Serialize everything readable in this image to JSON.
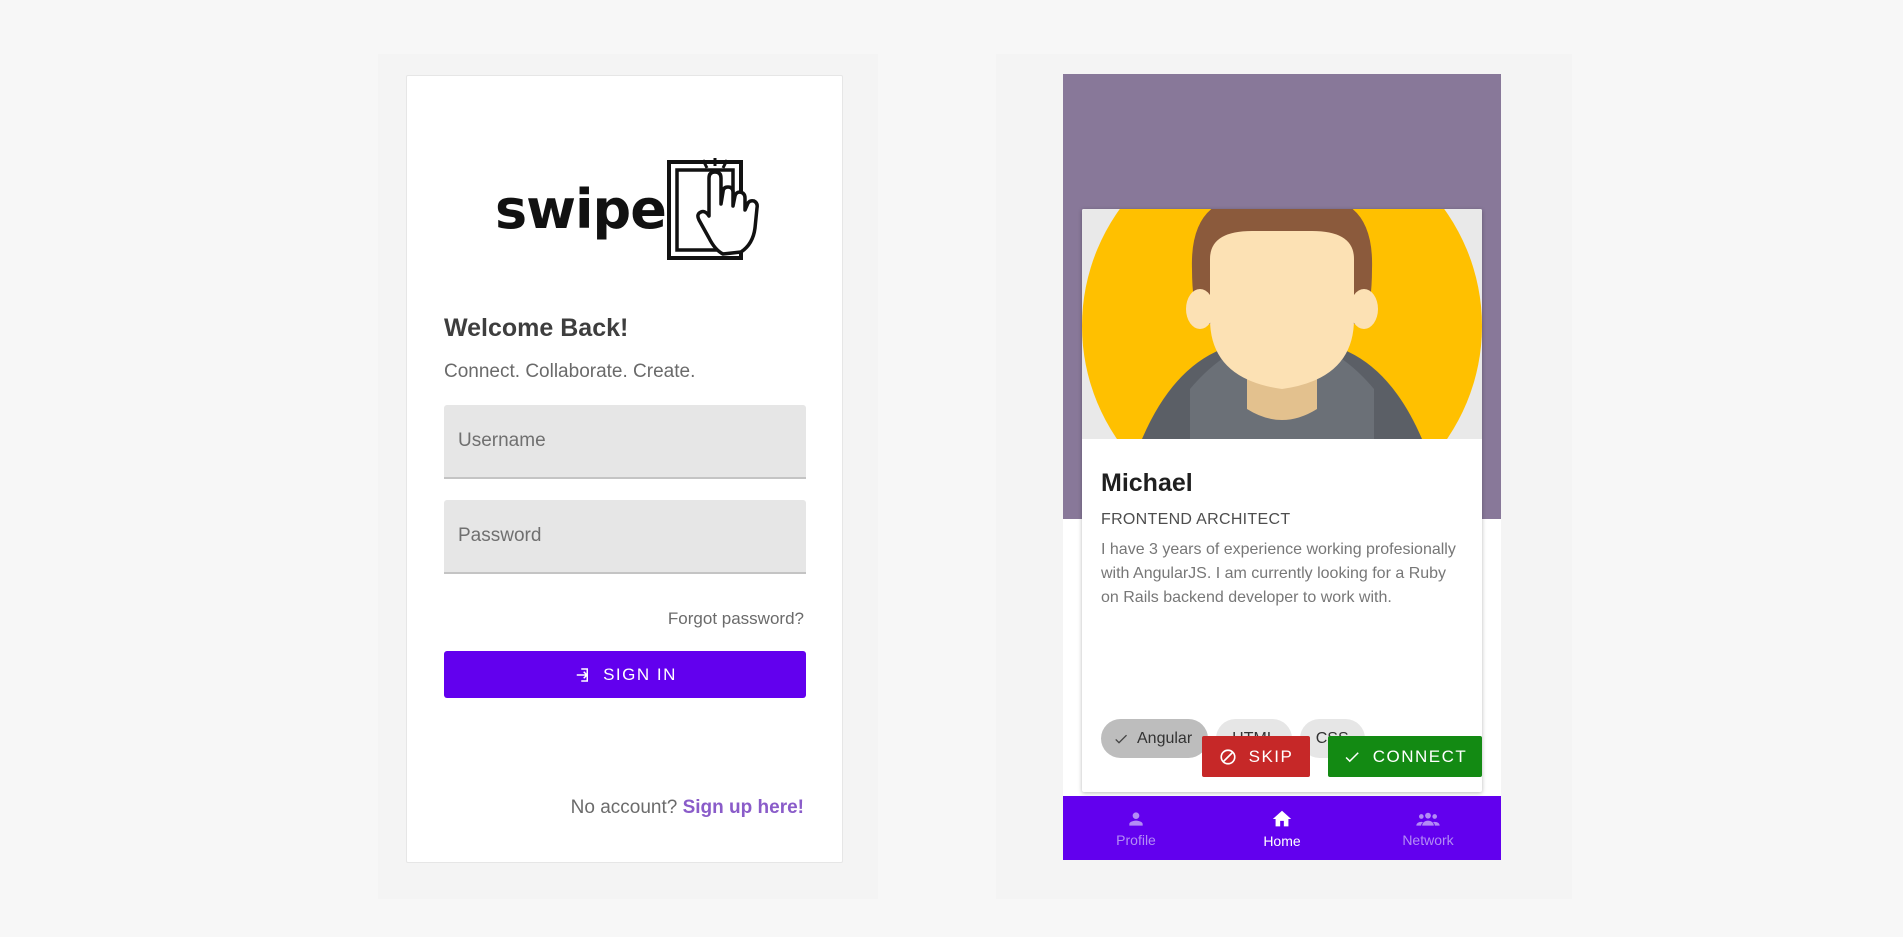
{
  "login": {
    "logo_text": "swipe",
    "title": "Welcome Back!",
    "tagline": "Connect. Collaborate. Create.",
    "username_placeholder": "Username",
    "password_placeholder": "Password",
    "forgot_label": "Forgot password?",
    "signin_label": "SIGN IN",
    "no_account_text": "No account?",
    "signup_label": "Sign up here!"
  },
  "profile": {
    "name": "Michael",
    "role": "FRONTEND ARCHITECT",
    "bio": "I have 3 years of experience working profesionally with AngularJS. I am currently looking for a Ruby on Rails backend developer to work with.",
    "skills": [
      {
        "label": "Angular",
        "selected": true
      },
      {
        "label": "HTML",
        "selected": false
      },
      {
        "label": "CSS",
        "selected": false
      }
    ],
    "skip_label": "SKIP",
    "connect_label": "CONNECT"
  },
  "nav": {
    "items": [
      {
        "label": "Profile",
        "icon": "person-icon",
        "active": false
      },
      {
        "label": "Home",
        "icon": "home-icon",
        "active": true
      },
      {
        "label": "Network",
        "icon": "group-icon",
        "active": false
      }
    ]
  },
  "colors": {
    "primary": "#6200ee",
    "header": "#887899",
    "skip": "#c62828",
    "connect": "#138a13",
    "avatar_bg": "#ffc000",
    "link": "#8a5cc9"
  }
}
